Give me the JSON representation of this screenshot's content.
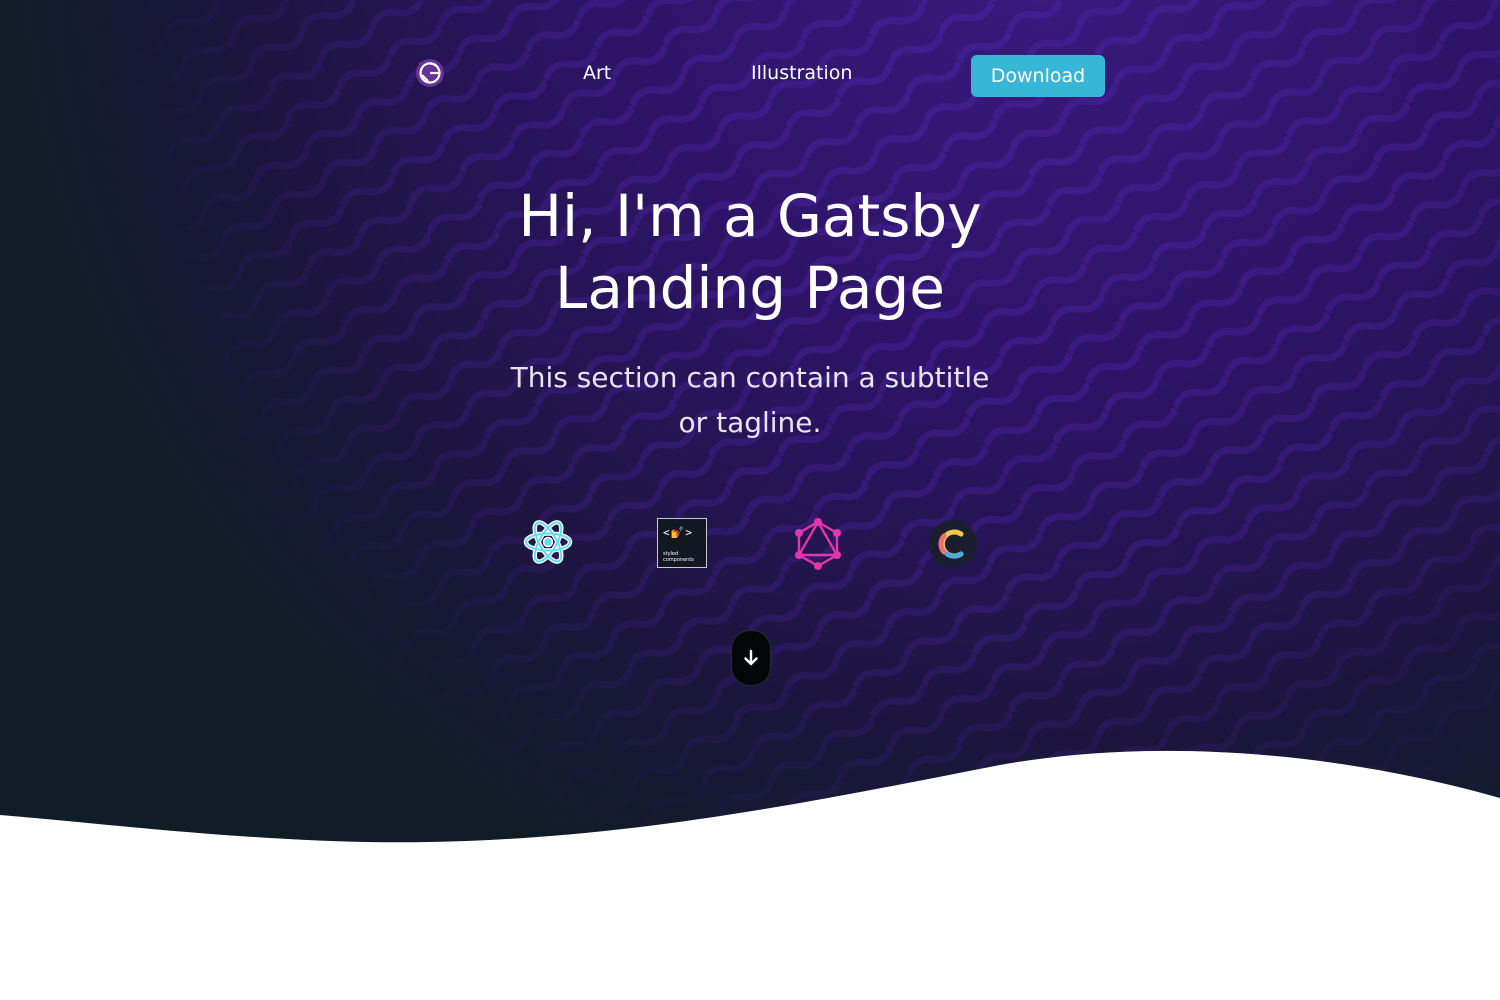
{
  "nav": {
    "logo_icon": "gatsby-logo-icon",
    "links": [
      {
        "label": "Art"
      },
      {
        "label": "Illustration"
      }
    ],
    "download_label": "Download"
  },
  "hero": {
    "title_line1": "Hi, I'm a Gatsby",
    "title_line2": "Landing Page",
    "subtitle_line1": "This section can contain a subtitle",
    "subtitle_line2": "or tagline."
  },
  "tech_icons": [
    {
      "icon": "react-icon"
    },
    {
      "icon": "styled-components-icon",
      "label": "styled\ncomponents",
      "code": "<💅>"
    },
    {
      "icon": "graphql-icon"
    },
    {
      "icon": "cypress-icon"
    }
  ],
  "scroll_button": {
    "icon": "arrow-down-icon"
  },
  "colors": {
    "accent": "#38b6d8",
    "hero_dark": "#101c27",
    "hero_purple": "#2d1466",
    "gatsby_purple": "#663399",
    "graphql_pink": "#e535ab",
    "react_blue": "#61dafb"
  }
}
